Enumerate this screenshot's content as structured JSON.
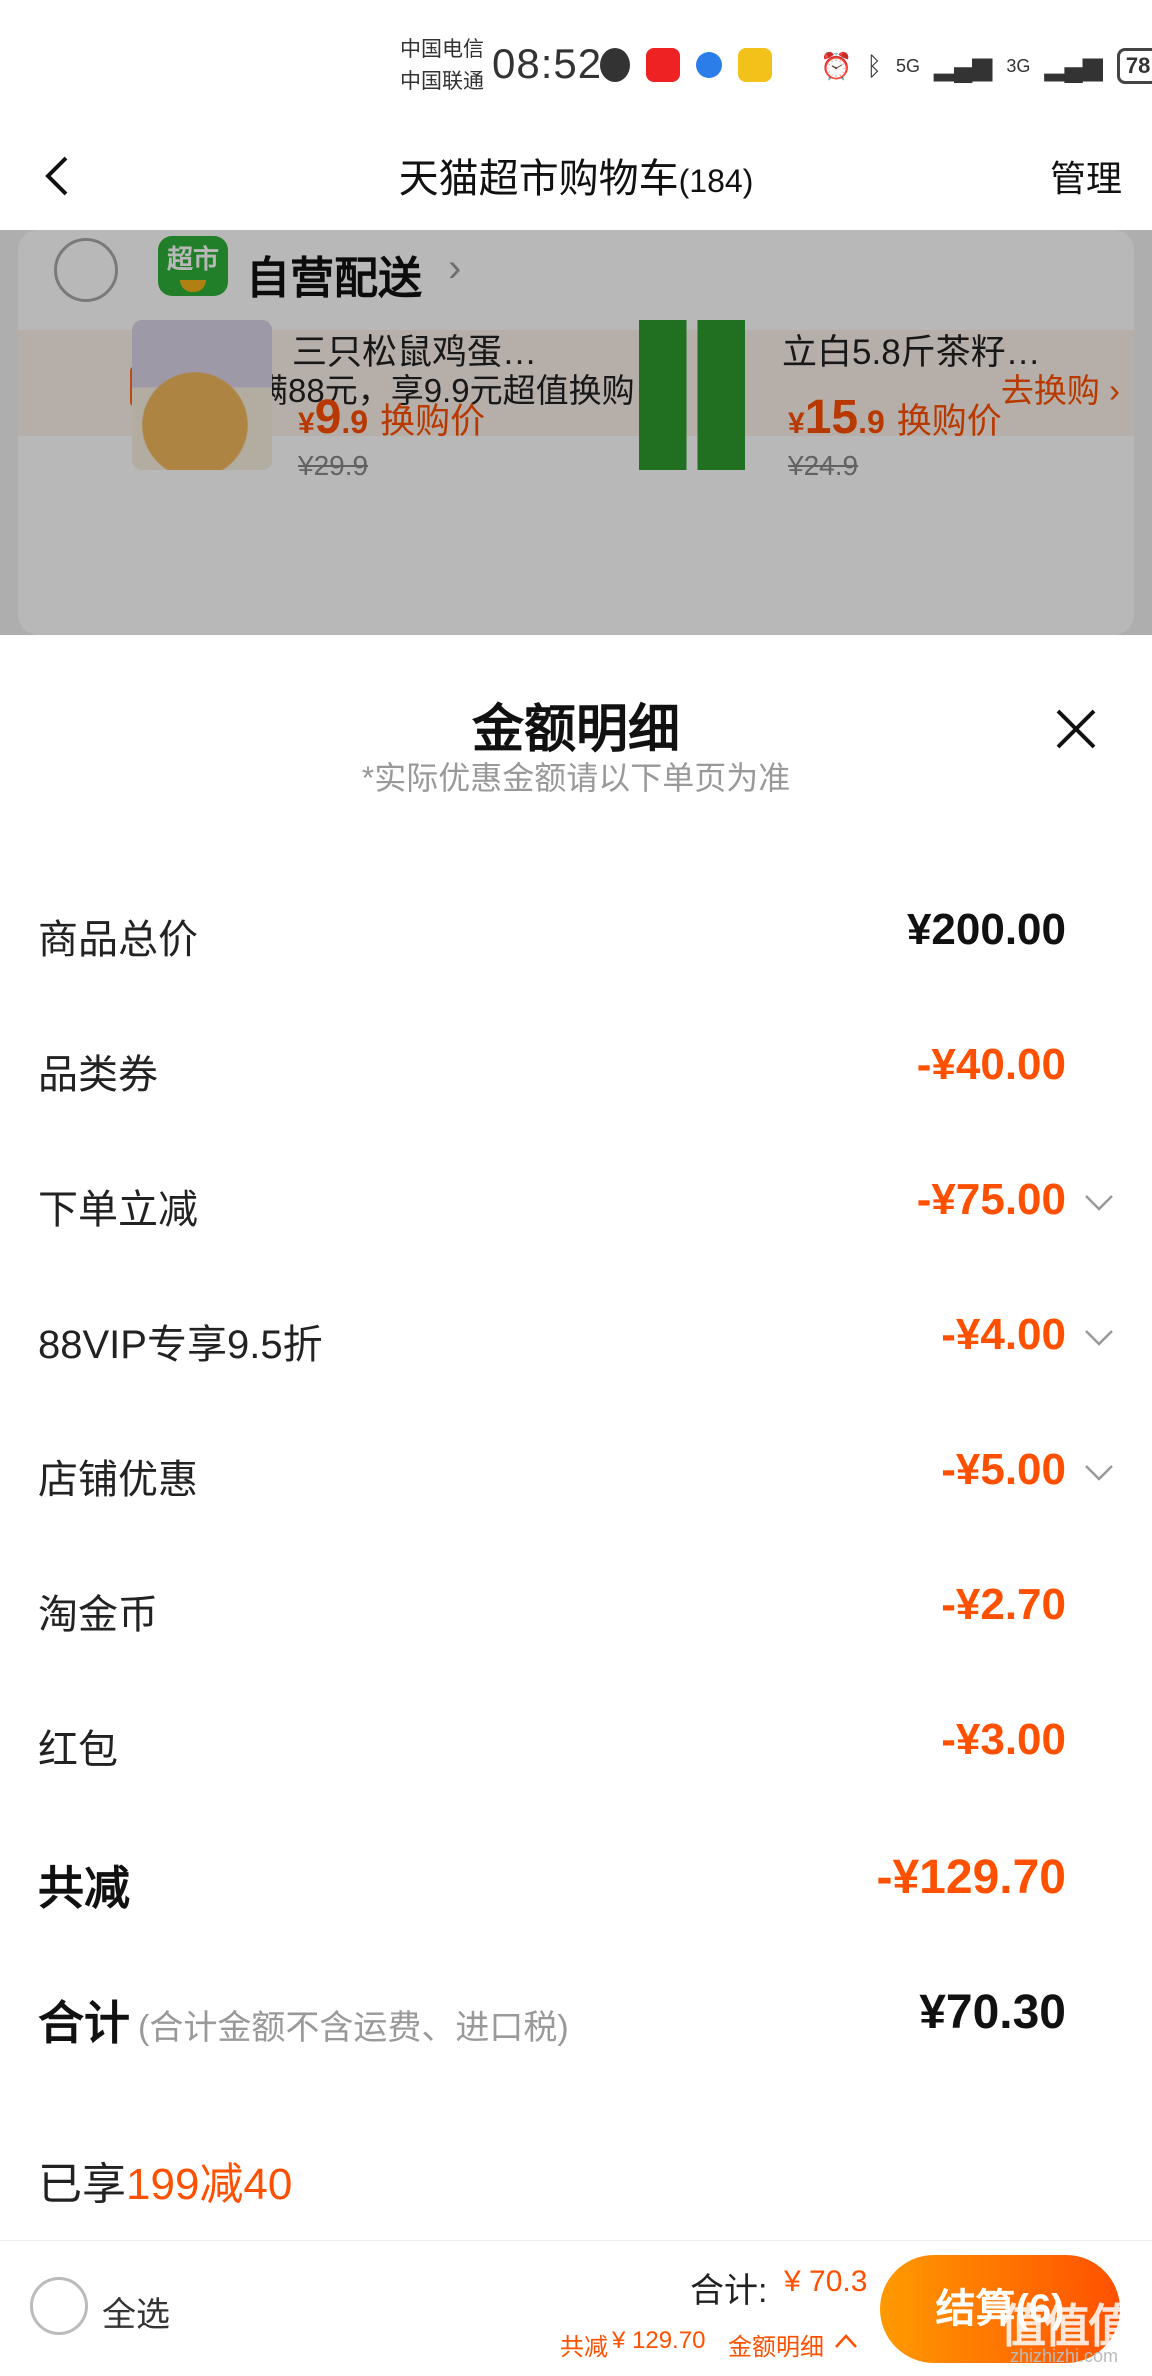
{
  "status_bar": {
    "carrier1": "中国电信",
    "carrier2": "中国联通",
    "time": "08:52",
    "signal1": "5G",
    "signal2": "3G",
    "battery": "78"
  },
  "nav": {
    "title": "天猫超市购物车",
    "count": "(184)",
    "manage": "管理"
  },
  "store": {
    "logo_text": "超市",
    "name": "自营配送",
    "swap_tag": "换购",
    "swap_text": "已满88元，享9.9元超值换购",
    "swap_link": "去换购 ›",
    "items": [
      {
        "name": "三只松鼠鸡蛋…",
        "currency": "¥",
        "price_int": "9",
        "price_dec": ".9",
        "price_label": "换购价",
        "orig": "¥29.9"
      },
      {
        "name": "立白5.8斤茶籽…",
        "currency": "¥",
        "price_int": "15",
        "price_dec": ".9",
        "price_label": "换购价",
        "orig": "¥24.9"
      }
    ]
  },
  "sheet": {
    "title": "金额明细",
    "subtitle": "*实际优惠金额请以下单页为准",
    "rows": [
      {
        "label": "商品总价",
        "value": "¥200.00"
      },
      {
        "label": "品类券",
        "value": "-¥40.00"
      },
      {
        "label": "下单立减",
        "value": "-¥75.00"
      },
      {
        "label": "88VIP专享9.5折",
        "value": "-¥4.00"
      },
      {
        "label": "店铺优惠",
        "value": "-¥5.00"
      },
      {
        "label": "淘金币",
        "value": "-¥2.70"
      },
      {
        "label": "红包",
        "value": "-¥3.00"
      },
      {
        "label": "共减",
        "value": "-¥129.70"
      },
      {
        "label": "合计",
        "note": "(合计金额不含运费、进口税)",
        "value": "¥70.30"
      }
    ],
    "promo_prefix": "已享",
    "promo_accent": "199减40"
  },
  "bottom": {
    "select_all": "全选",
    "total_label": "合计:",
    "total_value": "¥ 70.3",
    "reduce_label": "共减",
    "reduce_value": "¥ 129.70",
    "detail_link": "金额明细",
    "checkout": "结算(6)",
    "watermark": "值值值",
    "watermark_sub": "zhizhizhi.com"
  },
  "colors": {
    "accent": "#ff5000",
    "checkout_gradient_start": "#ff9a00",
    "store_logo": "#2fb03a"
  }
}
